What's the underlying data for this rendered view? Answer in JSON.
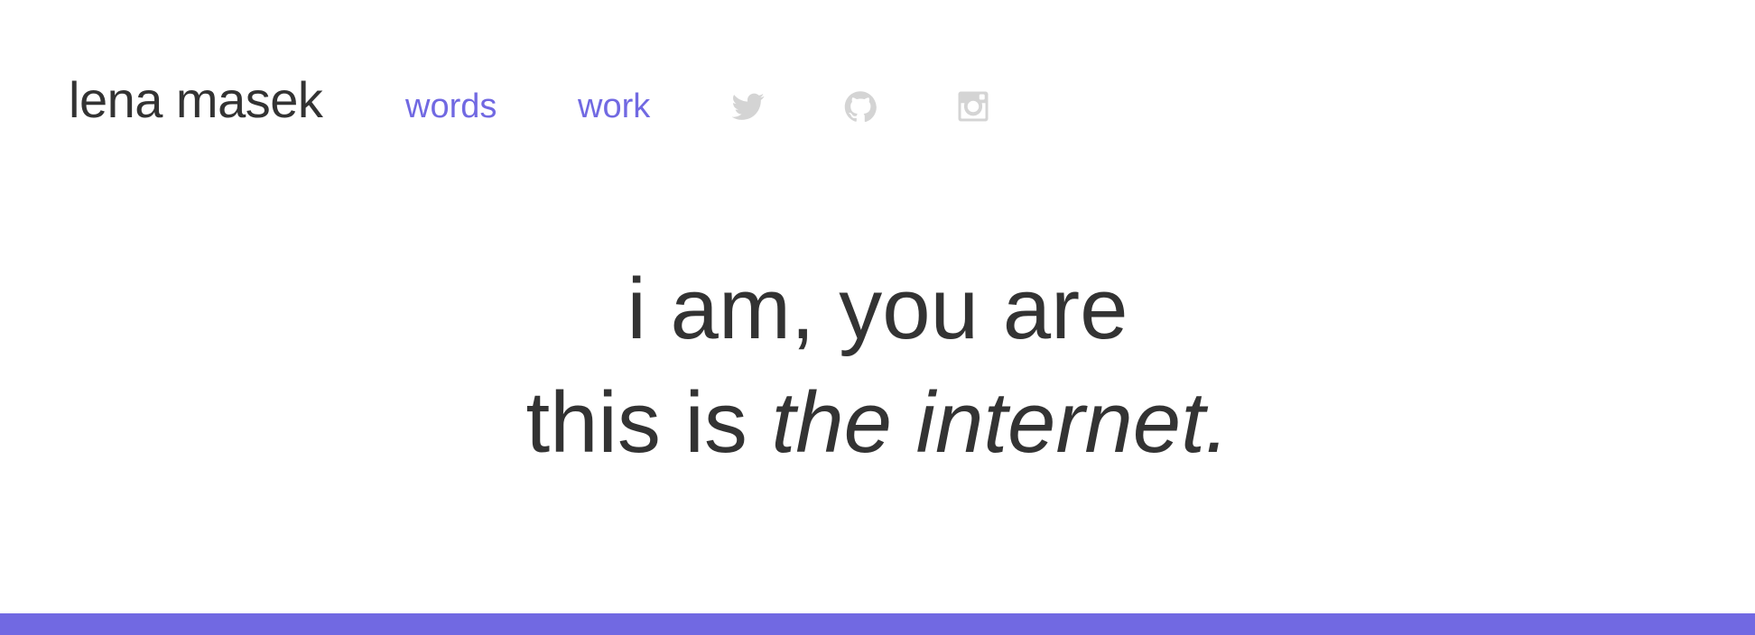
{
  "site": {
    "name": "lena masek"
  },
  "nav": {
    "links": [
      {
        "label": "words"
      },
      {
        "label": "work"
      }
    ],
    "social": [
      {
        "icon": "twitter-icon"
      },
      {
        "icon": "github-icon"
      },
      {
        "icon": "instagram-icon"
      }
    ]
  },
  "hero": {
    "line1": "i am, you are",
    "line2_prefix": "this is ",
    "line2_emphasis": "the internet."
  },
  "colors": {
    "accent": "#7169e2",
    "text": "#333333",
    "icon": "#d4d4d4",
    "background": "#ffffff"
  }
}
